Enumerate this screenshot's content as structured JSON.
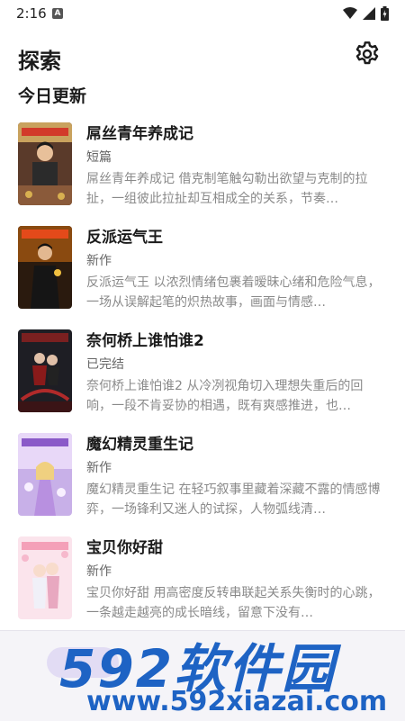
{
  "status_bar": {
    "time": "2:16",
    "notification_icon": "A",
    "icons": [
      "wifi-icon",
      "signal-icon",
      "battery-icon"
    ]
  },
  "header": {
    "title": "探索",
    "settings_icon": "gear-icon"
  },
  "section": {
    "title": "今日更新"
  },
  "books": [
    {
      "title": "屌丝青年养成记",
      "status": "短篇",
      "description": "屌丝青年养成记 借克制笔触勾勒出欲望与克制的拉扯，一组彼此拉扯却互相成全的关系，节奏…"
    },
    {
      "title": "反派运气王",
      "status": "新作",
      "description": "反派运气王 以浓烈情绪包裹着暧昧心绪和危险气息，一场从误解起笔的炽热故事，画面与情感…"
    },
    {
      "title": "奈何桥上谁怕谁2",
      "status": "已完结",
      "description": "奈何桥上谁怕谁2 从冷冽视角切入理想失重后的回响，一段不肯妥协的相遇，既有爽感推进，也…"
    },
    {
      "title": "魔幻精灵重生记",
      "status": "新作",
      "description": "魔幻精灵重生记 在轻巧叙事里藏着深藏不露的情感博弈，一场锋利又迷人的试探，人物弧线清…"
    },
    {
      "title": "宝贝你好甜",
      "status": "新作",
      "description": "宝贝你好甜 用高密度反转串联起关系失衡时的心跳，一条越走越亮的成长暗线，留意下没有…"
    }
  ],
  "watermark": {
    "brand": "592软件园",
    "url": "www.592xiazai.com",
    "color": "#1e63c4"
  },
  "colors": {
    "nav_pill": "#e2dcf4",
    "nav_background": "#f5f4f8"
  }
}
